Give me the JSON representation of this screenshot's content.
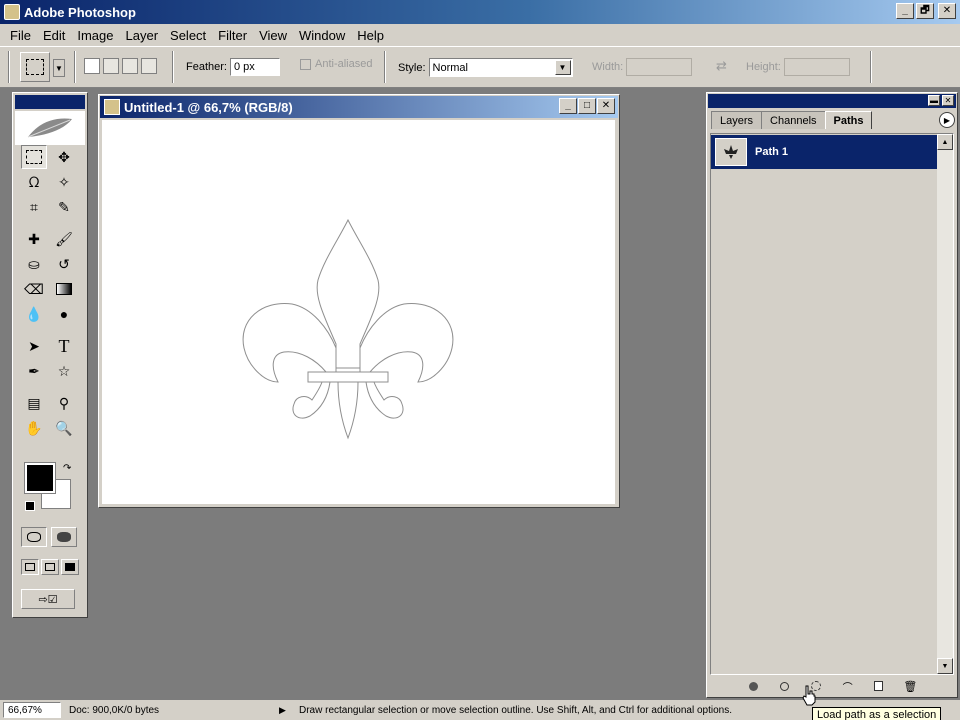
{
  "app": {
    "title": "Adobe Photoshop"
  },
  "window_controls": {
    "minimize": "_",
    "restore": "🗗",
    "close": "✕"
  },
  "menu": [
    "File",
    "Edit",
    "Image",
    "Layer",
    "Select",
    "Filter",
    "View",
    "Window",
    "Help"
  ],
  "options": {
    "feather_label": "Feather:",
    "feather_value": "0 px",
    "antialiased_label": "Anti-aliased",
    "style_label": "Style:",
    "style_value": "Normal",
    "width_label": "Width:",
    "height_label": "Height:"
  },
  "document": {
    "title": "Untitled-1 @ 66,7% (RGB/8)"
  },
  "panel": {
    "tabs": [
      "Layers",
      "Channels",
      "Paths"
    ],
    "active_tab": "Paths",
    "paths": [
      {
        "name": "Path 1"
      }
    ]
  },
  "status": {
    "zoom": "66,67%",
    "doc_info": "Doc: 900,0K/0 bytes",
    "hint": "Draw rectangular selection or move selection outline.  Use Shift, Alt, and Ctrl for additional options."
  },
  "tooltip": "Load path as a selection",
  "colors": {
    "title_dark": "#0a246a",
    "title_light": "#a6caf0",
    "chrome": "#d4d0c8",
    "workspace": "#7c7c7c",
    "foreground": "#000000",
    "background": "#ffffff"
  }
}
